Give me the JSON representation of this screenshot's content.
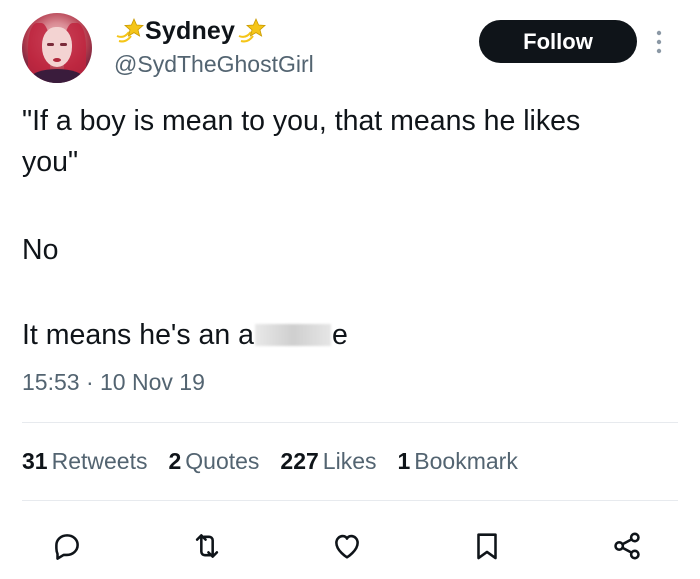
{
  "author": {
    "display_name": "Sydney",
    "handle": "@SydTheGhostGirl",
    "name_emoji": "shooting-star-icon",
    "follow_label": "Follow"
  },
  "tweet": {
    "lines": [
      "\"If a boy is mean to you, that means he likes",
      "you\"",
      "No"
    ],
    "last_line_prefix": "It means he's an a",
    "last_line_suffix": "e",
    "time": "15:53",
    "separator": "·",
    "date": "10 Nov 19"
  },
  "stats": {
    "retweets_count": "31",
    "retweets_label": "Retweets",
    "quotes_count": "2",
    "quotes_label": "Quotes",
    "likes_count": "227",
    "likes_label": "Likes",
    "bookmarks_count": "1",
    "bookmarks_label": "Bookmark"
  },
  "actions": [
    "reply-icon",
    "retweet-icon",
    "like-icon",
    "bookmark-icon",
    "share-icon"
  ],
  "colors": {
    "text": "#0f1419",
    "secondary": "#536471",
    "divider": "#e7eaee",
    "follow_bg": "#0f1419",
    "star": "#f5c518"
  }
}
